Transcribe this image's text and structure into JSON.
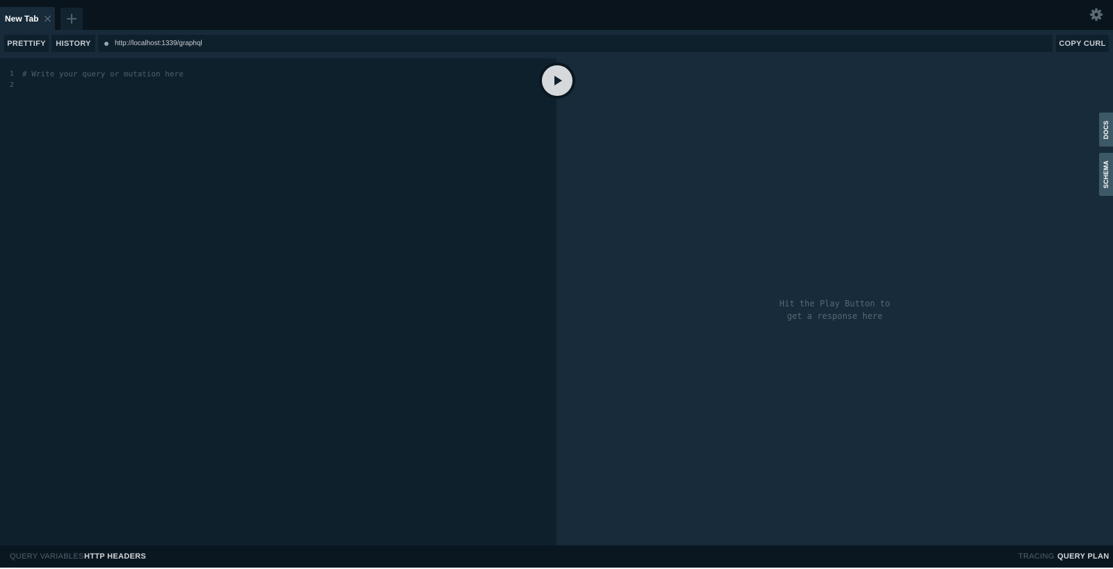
{
  "tabs": [
    {
      "label": "New Tab",
      "active": true
    }
  ],
  "toolbar": {
    "prettify_label": "PRETTIFY",
    "history_label": "HISTORY",
    "endpoint_url": "http://localhost:1339/graphql",
    "copy_curl_label": "COPY CURL"
  },
  "editor": {
    "lines": [
      {
        "number": "1",
        "text": "# Write your query or mutation here"
      },
      {
        "number": "2",
        "text": ""
      }
    ]
  },
  "results": {
    "placeholder_line1": "Hit the Play Button to",
    "placeholder_line2": "get a response here"
  },
  "side_tabs": {
    "docs_label": "DOCS",
    "schema_label": "SCHEMA"
  },
  "bottom_bar": {
    "query_variables_label": "QUERY VARIABLES",
    "http_headers_label": "HTTP HEADERS",
    "tracing_label": "TRACING",
    "query_plan_label": "QUERY PLAN"
  },
  "icons": {
    "tab_close": "close-icon",
    "new_tab": "plus-icon",
    "settings": "gear-icon",
    "play": "play-icon",
    "status": "status-dot-icon"
  },
  "colors": {
    "editor_bg": "#0f202d",
    "results_bg": "#172b3a",
    "tabbar_bg": "#09141c",
    "side_tab_bg": "#3d5866"
  }
}
